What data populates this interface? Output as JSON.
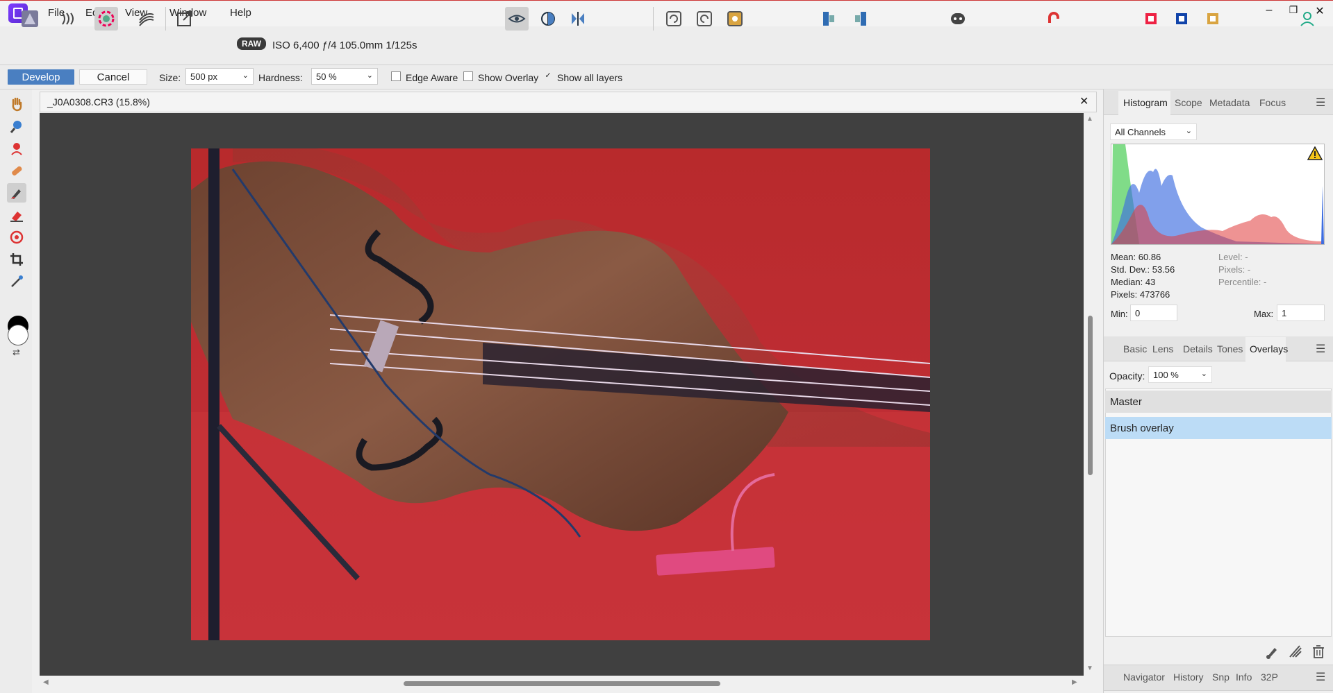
{
  "menu": {
    "items": [
      "File",
      "Edit",
      "View",
      "Window",
      "Help"
    ]
  },
  "window_controls": {
    "minimize": "–",
    "restore": "❐",
    "close": "✕"
  },
  "toolbar": {
    "raw_badge": "RAW",
    "exif": "ISO 6,400 ƒ/4 105.0mm 1/125s"
  },
  "context": {
    "develop": "Develop",
    "cancel": "Cancel",
    "size_label": "Size:",
    "size_value": "500 px",
    "hardness_label": "Hardness:",
    "hardness_value": "50 %",
    "edge_aware": "Edge Aware",
    "show_overlay": "Show Overlay",
    "show_all_layers": "Show all layers",
    "show_all_layers_checked": true
  },
  "document": {
    "title": "_J0A0308.CR3 (15.8%)",
    "close": "✕"
  },
  "histogram_panel": {
    "tabs": [
      "Histogram",
      "Scope",
      "Metadata",
      "Focus"
    ],
    "channel": "All Channels",
    "stats_left": [
      "Mean: 60.86",
      "Std. Dev.: 53.56",
      "Median: 43",
      "Pixels: 473766"
    ],
    "stats_right": [
      "Level: -",
      "Pixels: -",
      "Percentile: -"
    ],
    "min_label": "Min:",
    "min_value": "0",
    "max_label": "Max:",
    "max_value": "1"
  },
  "develop_panel": {
    "tabs": [
      "Basic",
      "Lens",
      "Details",
      "Tones",
      "Overlays"
    ],
    "opacity_label": "Opacity:",
    "opacity_value": "100 %",
    "layers": [
      "Master",
      "Brush overlay"
    ]
  },
  "bottom_panel": {
    "tabs": [
      "Navigator",
      "History",
      "Snp",
      "Info",
      "32P"
    ]
  },
  "colors": {
    "accent": "#4a7fc1",
    "overlay_red": "#c82a2e",
    "selection": "#bcdcf6"
  }
}
